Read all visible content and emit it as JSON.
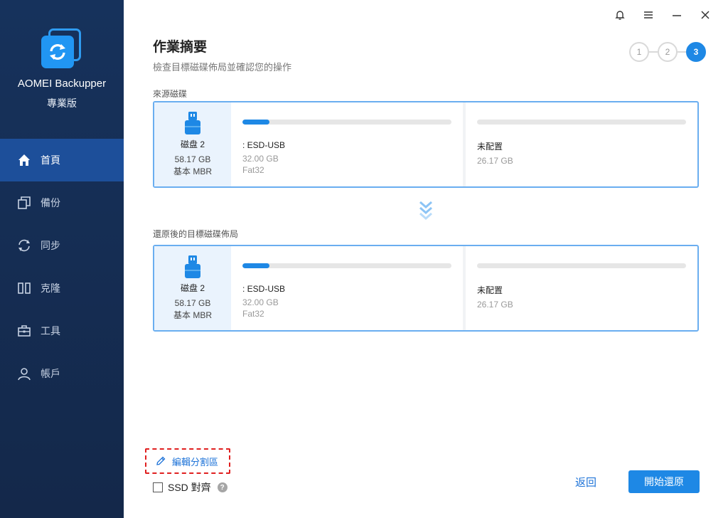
{
  "app": {
    "name": "AOMEI Backupper",
    "edition": "專業版"
  },
  "sidebar": {
    "items": [
      {
        "label": "首頁",
        "icon": "home-icon",
        "active": true
      },
      {
        "label": "備份",
        "icon": "backup-icon",
        "active": false
      },
      {
        "label": "同步",
        "icon": "sync-icon",
        "active": false
      },
      {
        "label": "克隆",
        "icon": "clone-icon",
        "active": false
      },
      {
        "label": "工具",
        "icon": "tools-icon",
        "active": false
      },
      {
        "label": "帳戶",
        "icon": "account-icon",
        "active": false
      }
    ]
  },
  "page": {
    "title": "作業摘要",
    "subtitle": "檢查目標磁碟佈局並確認您的操作"
  },
  "steps": [
    "1",
    "2",
    "3"
  ],
  "source": {
    "label": "來源磁碟",
    "disk": {
      "name": "磁盘 2",
      "size": "58.17 GB",
      "type": "基本 MBR"
    },
    "partitions": [
      {
        "name": ": ESD-USB",
        "size": "32.00 GB",
        "fs": "Fat32",
        "used_fraction": 0.13
      },
      {
        "name": "未配置",
        "size": "26.17 GB",
        "fs": "",
        "used_fraction": 0
      }
    ]
  },
  "target": {
    "label": "還原後的目標磁碟佈局",
    "disk": {
      "name": "磁盘 2",
      "size": "58.17 GB",
      "type": "基本 MBR"
    },
    "partitions": [
      {
        "name": ": ESD-USB",
        "size": "32.00 GB",
        "fs": "Fat32",
        "used_fraction": 0.13
      },
      {
        "name": "未配置",
        "size": "26.17 GB",
        "fs": "",
        "used_fraction": 0
      }
    ]
  },
  "footer": {
    "edit_partition": "編輯分割區",
    "ssd_align": "SSD 對齊",
    "ssd_help": "?",
    "back": "返回",
    "start": "開始還原"
  },
  "colors": {
    "sidebar_bg": "#16325c",
    "accent": "#1e88e5",
    "active_nav": "#1d4f9a"
  }
}
